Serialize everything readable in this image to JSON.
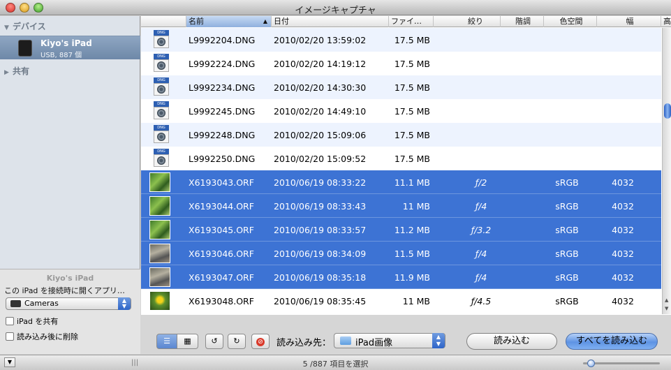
{
  "window": {
    "title": "イメージキャプチャ"
  },
  "sidebar": {
    "devices_label": "デバイス",
    "device": {
      "name": "Kiyo's iPad",
      "sub": "USB, 887 個"
    },
    "shared_label": "共有",
    "panel_title": "Kiyo's iPad",
    "open_app_label": "この iPad を接続時に開くアプリ…",
    "app_popup_value": "Cameras",
    "share_checkbox": "iPad を共有",
    "delete_checkbox": "読み込み後に削除"
  },
  "columns": {
    "name": "名前",
    "date": "日付",
    "size": "ファイ…",
    "aperture": "絞り",
    "tone": "階調",
    "colorspace": "色空間",
    "width": "幅",
    "extra": "高"
  },
  "rows": [
    {
      "name": "L9992204.DNG",
      "date": "2010/02/20 13:59:02",
      "size": "17.5 MB",
      "aperture": "",
      "cs": "",
      "w": "",
      "thumb": "dng",
      "selected": false
    },
    {
      "name": "L9992224.DNG",
      "date": "2010/02/20 14:19:12",
      "size": "17.5 MB",
      "aperture": "",
      "cs": "",
      "w": "",
      "thumb": "dng",
      "selected": false
    },
    {
      "name": "L9992234.DNG",
      "date": "2010/02/20 14:30:30",
      "size": "17.5 MB",
      "aperture": "",
      "cs": "",
      "w": "",
      "thumb": "dng",
      "selected": false
    },
    {
      "name": "L9992245.DNG",
      "date": "2010/02/20 14:49:10",
      "size": "17.5 MB",
      "aperture": "",
      "cs": "",
      "w": "",
      "thumb": "dng",
      "selected": false
    },
    {
      "name": "L9992248.DNG",
      "date": "2010/02/20 15:09:06",
      "size": "17.5 MB",
      "aperture": "",
      "cs": "",
      "w": "",
      "thumb": "dng",
      "selected": false
    },
    {
      "name": "L9992250.DNG",
      "date": "2010/02/20 15:09:52",
      "size": "17.5 MB",
      "aperture": "",
      "cs": "",
      "w": "",
      "thumb": "dng",
      "selected": false
    },
    {
      "name": "X6193043.ORF",
      "date": "2010/06/19 08:33:22",
      "size": "11.1 MB",
      "aperture": "ƒ/2",
      "cs": "sRGB",
      "w": "4032",
      "thumb": "photo",
      "selected": true
    },
    {
      "name": "X6193044.ORF",
      "date": "2010/06/19 08:33:43",
      "size": "11 MB",
      "aperture": "ƒ/4",
      "cs": "sRGB",
      "w": "4032",
      "thumb": "photo",
      "selected": true
    },
    {
      "name": "X6193045.ORF",
      "date": "2010/06/19 08:33:57",
      "size": "11.2 MB",
      "aperture": "ƒ/3.2",
      "cs": "sRGB",
      "w": "4032",
      "thumb": "photo",
      "selected": true
    },
    {
      "name": "X6193046.ORF",
      "date": "2010/06/19 08:34:09",
      "size": "11.5 MB",
      "aperture": "ƒ/4",
      "cs": "sRGB",
      "w": "4032",
      "thumb": "gray",
      "selected": true
    },
    {
      "name": "X6193047.ORF",
      "date": "2010/06/19 08:35:18",
      "size": "11.9 MB",
      "aperture": "ƒ/4",
      "cs": "sRGB",
      "w": "4032",
      "thumb": "gray",
      "selected": true
    },
    {
      "name": "X6193048.ORF",
      "date": "2010/06/19 08:35:45",
      "size": "11 MB",
      "aperture": "ƒ/4.5",
      "cs": "sRGB",
      "w": "4032",
      "thumb": "yellow",
      "selected": false
    }
  ],
  "toolbar": {
    "import_to_label": "読み込み先：",
    "destination": "iPad画像",
    "import_button": "読み込む",
    "import_all_button": "すべてを読み込む"
  },
  "status": {
    "text": "5 /887 項目を選択",
    "zoom_fraction": 0.05
  },
  "colors": {
    "selection": "#3d73d4",
    "alt_row": "#edf3fe"
  }
}
